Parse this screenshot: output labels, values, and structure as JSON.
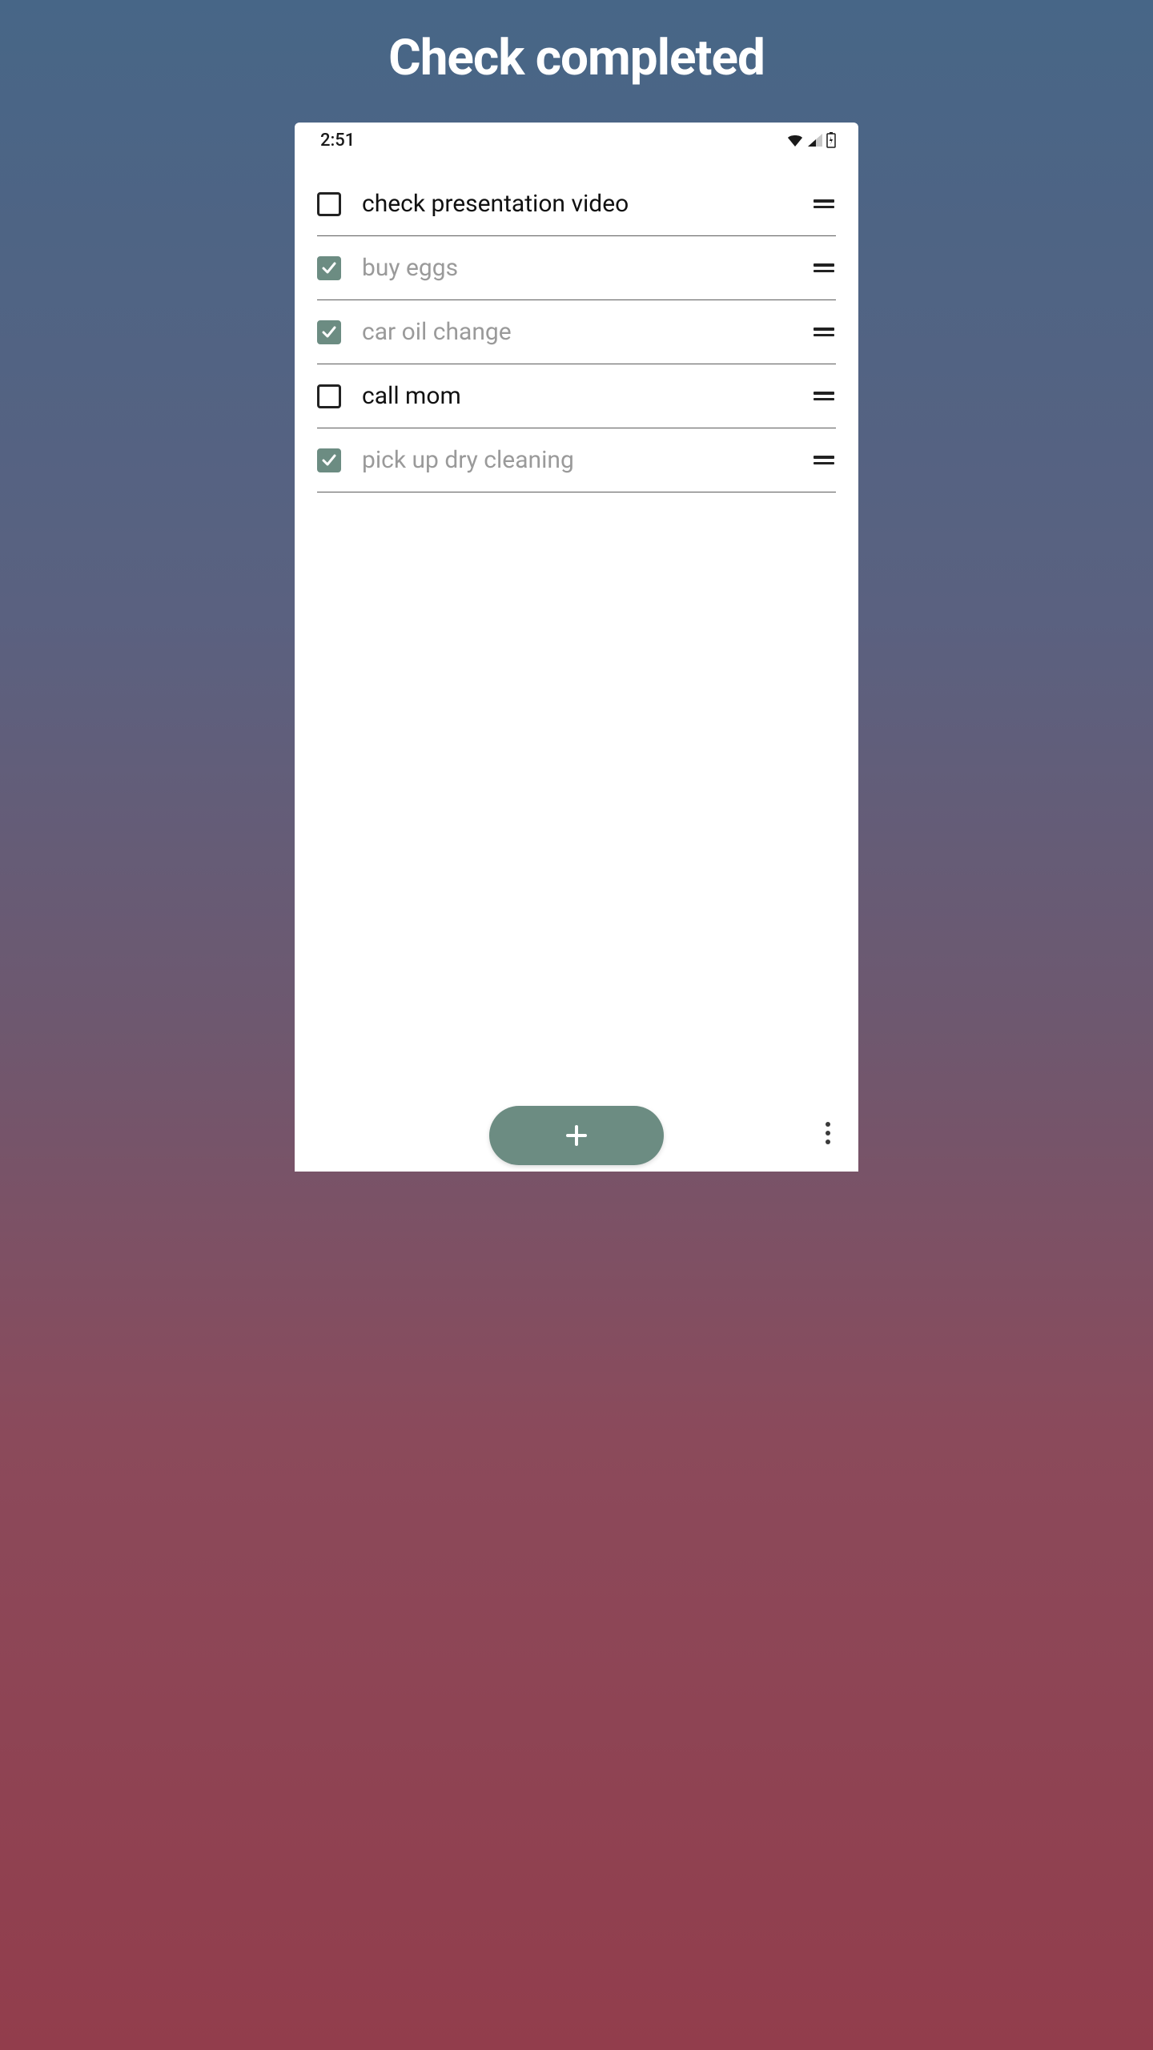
{
  "title": "Check completed",
  "status_bar": {
    "time": "2:51"
  },
  "tasks": [
    {
      "label": "check presentation video",
      "completed": false
    },
    {
      "label": "buy eggs",
      "completed": true
    },
    {
      "label": "car oil change",
      "completed": true
    },
    {
      "label": "call mom",
      "completed": false
    },
    {
      "label": "pick up dry cleaning",
      "completed": true
    }
  ],
  "colors": {
    "accent": "#6c8c82"
  }
}
